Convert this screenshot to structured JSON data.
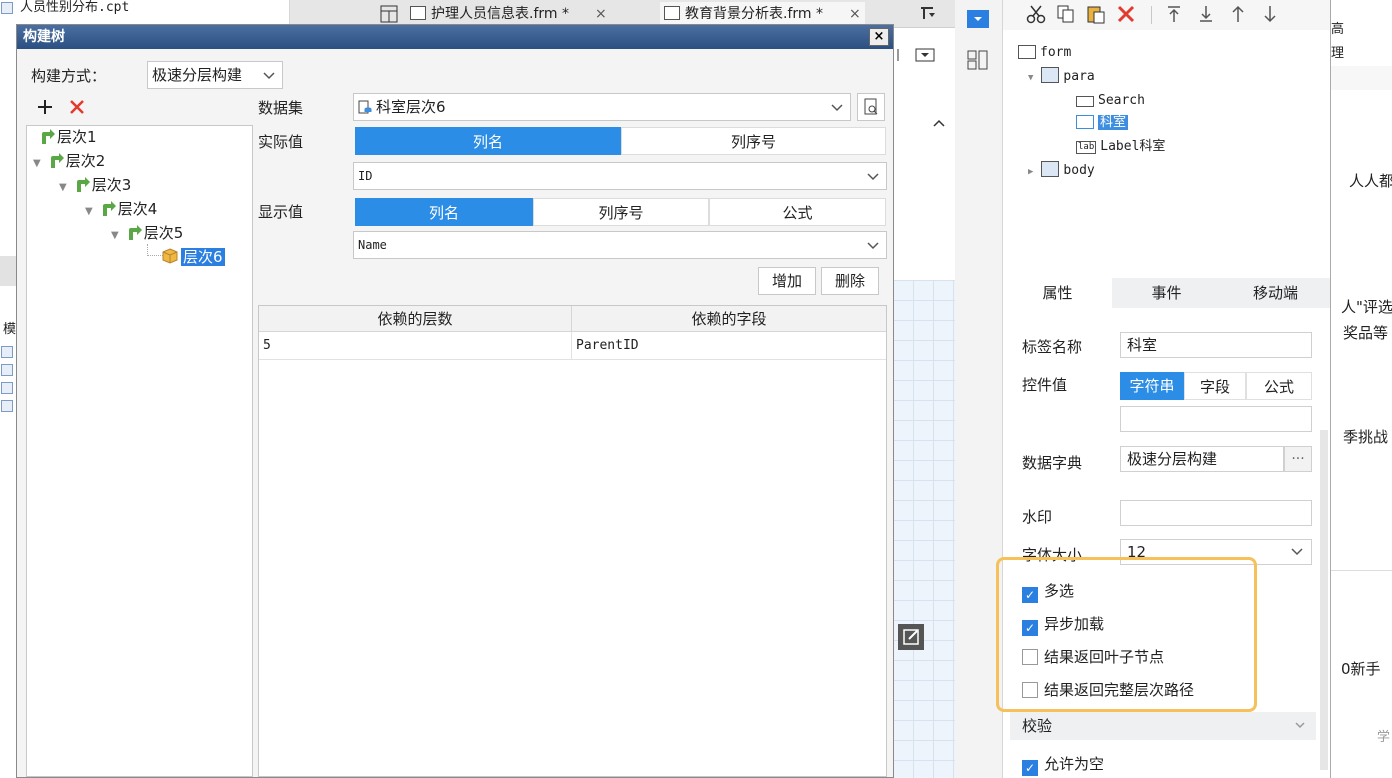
{
  "left_strip": {
    "file_name": "人员性别分布.cpt",
    "section_label": "模"
  },
  "tabs": [
    {
      "label": "护理人员信息表.frm *",
      "close": "×"
    },
    {
      "label": "教育背景分析表.frm *",
      "close": "×"
    }
  ],
  "dialog": {
    "title": "构建树",
    "close": "×",
    "build_mode_label": "构建方式：",
    "build_mode_value": "极速分层构建",
    "tree": {
      "nodes": [
        {
          "label": "层次1",
          "level": 0,
          "expanded": false
        },
        {
          "label": "层次2",
          "level": 0,
          "expanded": true
        },
        {
          "label": "层次3",
          "level": 1,
          "expanded": true
        },
        {
          "label": "层次4",
          "level": 2,
          "expanded": true
        },
        {
          "label": "层次5",
          "level": 3,
          "expanded": true
        },
        {
          "label": "层次6",
          "level": 4,
          "selected": true
        }
      ]
    },
    "dataset_label": "数据集",
    "dataset_value": "科室层次6",
    "actual_value_label": "实际值",
    "actual_value_tabs": [
      "列名",
      "列序号"
    ],
    "actual_value_field": "ID",
    "display_value_label": "显示值",
    "display_value_tabs": [
      "列名",
      "列序号",
      "公式"
    ],
    "display_value_field": "Name",
    "add_button": "增加",
    "delete_button": "删除",
    "grid": {
      "headers": [
        "依赖的层数",
        "依赖的字段"
      ],
      "rows": [
        [
          "5",
          "ParentID"
        ]
      ]
    }
  },
  "widget_tree": {
    "root": "form",
    "para": "para",
    "search": "Search",
    "keshi": "科室",
    "label_keshi": "Label科室",
    "body": "body",
    "lab_badge": "lab"
  },
  "properties": {
    "tabs": [
      "属性",
      "事件",
      "移动端"
    ],
    "label_name_label": "标签名称",
    "label_name_value": "科室",
    "control_value_label": "控件值",
    "control_value_tabs": [
      "字符串",
      "字段",
      "公式"
    ],
    "control_value_input": "",
    "dict_label": "数据字典",
    "dict_value": "极速分层构建",
    "dict_more": "···",
    "watermark_label": "水印",
    "watermark_value": "",
    "font_size_label": "字体大小",
    "font_size_value": "12",
    "checkboxes": [
      {
        "label": "多选",
        "checked": true
      },
      {
        "label": "异步加载",
        "checked": true
      },
      {
        "label": "结果返回叶子节点",
        "checked": false
      },
      {
        "label": "结果返回完整层次路径",
        "checked": false
      }
    ],
    "validate_label": "校验",
    "allow_empty_label": "允许为空",
    "allow_empty_checked": true
  },
  "far_right": {
    "texts": [
      "高",
      "理",
      "人人都",
      "人\"评选",
      "奖品等",
      "季挑战",
      "0新手",
      "学"
    ]
  },
  "colors": {
    "accent": "#2b8de6",
    "highlight": "#f6c15a",
    "dialog_title": "#2c4f82"
  }
}
